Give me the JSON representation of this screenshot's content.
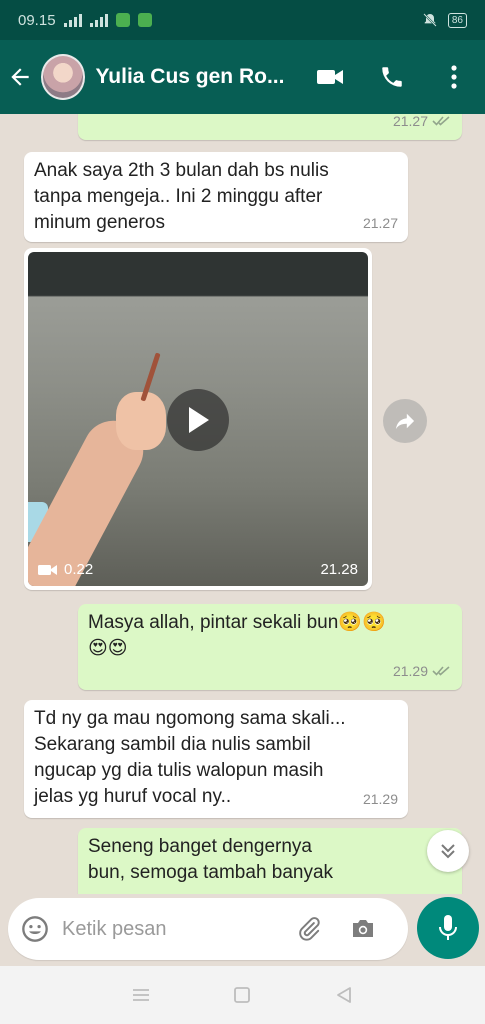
{
  "status_bar": {
    "time": "09.15",
    "battery": "86"
  },
  "header": {
    "title": "Yulia Cus gen Ro..."
  },
  "messages": [
    {
      "time": "21.27"
    },
    {
      "text": "Anak saya 2th 3 bulan dah bs nulis\ntanpa mengeja.. Ini 2 minggu after\nminum generos",
      "time": "21.27"
    },
    {
      "duration": "0.22",
      "time": "21.28"
    },
    {
      "text": "Masya allah, pintar sekali bun🥺🥺\n😍😍",
      "time": "21.29"
    },
    {
      "text": "Td ny ga mau ngomong sama skali...\nSekarang sambil dia nulis sambil\nngucap yg dia tulis walopun masih\njelas yg huruf vocal ny..",
      "time": "21.29"
    },
    {
      "text": "Seneng banget dengernya\nbun, semoga tambah banyak"
    }
  ],
  "input": {
    "placeholder": "Ketik pesan"
  },
  "colors": {
    "header": "#075e54",
    "statusbar": "#054d44",
    "outgoing": "#dcf8c6",
    "incoming": "#ffffff",
    "accent": "#00897b"
  }
}
